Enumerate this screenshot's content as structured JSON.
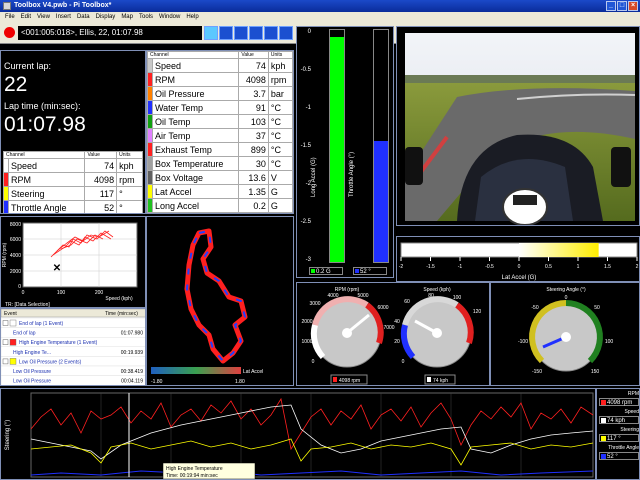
{
  "window": {
    "title": "Toolbox V4.pwb - Pi Toolbox*"
  },
  "menu": [
    "File",
    "Edit",
    "View",
    "Insert",
    "Data",
    "Display",
    "Map",
    "Tools",
    "Window",
    "Help"
  ],
  "toolbar": {
    "session": "<001:005:018>, Ellis, 22, 01:07.98"
  },
  "lap": {
    "current_label": "Current lap:",
    "current_value": "22",
    "time_label": "Lap time  (min:sec):",
    "time_value": "01:07.98"
  },
  "mini_table": {
    "headers": [
      "Channel",
      "Value",
      "Units"
    ],
    "rows": [
      {
        "name": "Speed",
        "value": "74",
        "unit": "kph",
        "color": "#ffffff"
      },
      {
        "name": "RPM",
        "value": "4098",
        "unit": "rpm",
        "color": "#ff2020"
      },
      {
        "name": "Steering",
        "value": "117",
        "unit": "°",
        "color": "#ffff00"
      },
      {
        "name": "Throttle Angle",
        "value": "52",
        "unit": "°",
        "color": "#2030ff"
      }
    ]
  },
  "channel_table": {
    "headers": [
      "Channel",
      "Value",
      "Units"
    ],
    "rows": [
      {
        "name": "Speed",
        "value": "74",
        "unit": "kph",
        "color": "#c8c8c8"
      },
      {
        "name": "RPM",
        "value": "4098",
        "unit": "rpm",
        "color": "#ff2020"
      },
      {
        "name": "Oil Pressure",
        "value": "3.7",
        "unit": "bar",
        "color": "#ff8000"
      },
      {
        "name": "Water Temp",
        "value": "91",
        "unit": "°C",
        "color": "#2030ff"
      },
      {
        "name": "Oil Temp",
        "value": "103",
        "unit": "°C",
        "color": "#10a010"
      },
      {
        "name": "Air Temp",
        "value": "37",
        "unit": "°C",
        "color": "#e080ff"
      },
      {
        "name": "Exhaust Temp",
        "value": "899",
        "unit": "°C",
        "color": "#ff2020"
      },
      {
        "name": "Box Temperature",
        "value": "30",
        "unit": "°C",
        "color": "#a0a0a0"
      },
      {
        "name": "Box Voltage",
        "value": "13.6",
        "unit": "V",
        "color": "#606060"
      },
      {
        "name": "Lat Accel",
        "value": "1.35",
        "unit": "G",
        "color": "#ffff00"
      },
      {
        "name": "Long Accel",
        "value": "0.2",
        "unit": "G",
        "color": "#20c020"
      }
    ]
  },
  "bars": {
    "long_label": "Long Accel (G)",
    "throttle_label": "Throttle Angle (°)",
    "axis_ticks": [
      "0",
      "-0.5",
      "-1",
      "-1.5",
      "-2",
      "-2.5",
      "-3"
    ],
    "long_value": "0.2 G",
    "throttle_value": "52 °",
    "long_fill": 0.97,
    "throttle_fill": 0.52,
    "long_color": "#00ff00",
    "throttle_color": "#2030ff"
  },
  "lat_bar": {
    "label": "Lat Accel (G)",
    "ticks": [
      "-2",
      "-1.5",
      "-1",
      "-0.5",
      "0",
      "0.5",
      "1",
      "1.5",
      "2"
    ],
    "value": 1.35,
    "min": -2,
    "max": 2
  },
  "scatter": {
    "ylabel": "RPM (rpm)",
    "xlabel": "Speed (kph)",
    "footer": "TR: [Data Selection]",
    "yticks": [
      "8000",
      "6000",
      "4000",
      "2000",
      "0"
    ],
    "xticks": [
      "0",
      "100",
      "200"
    ]
  },
  "events": {
    "headers": [
      "Event",
      "Time (min:sec)"
    ],
    "rows": [
      {
        "label": "End of lap (1 Event)",
        "time": "",
        "group": true,
        "color": "#ffffff"
      },
      {
        "label": "End of lap",
        "time": "01:07.980",
        "group": false,
        "color": ""
      },
      {
        "label": "High Engine Temperature (1 Event)",
        "time": "",
        "group": true,
        "color": "#ff2020"
      },
      {
        "label": "High Engine Te...",
        "time": "00:19.939",
        "group": false,
        "color": ""
      },
      {
        "label": "Low Oil Pressure (2 Events)",
        "time": "",
        "group": true,
        "color": "#ffff00"
      },
      {
        "label": "Low Oil Pressure",
        "time": "00:38.419",
        "group": false,
        "color": ""
      },
      {
        "label": "Low Oil Pressure",
        "time": "00:04.119",
        "group": false,
        "color": ""
      }
    ]
  },
  "track": {
    "legend_label": "Lat Accel",
    "min": "-1.80",
    "max": "1.80"
  },
  "gauges": {
    "rpm": {
      "title": "RPM (rpm)",
      "ticks": [
        "0",
        "1000",
        "2000",
        "3000",
        "4000",
        "5000",
        "6000",
        "7000"
      ],
      "value": "4098 rpm"
    },
    "speed": {
      "title": "Speed (kph)",
      "ticks": [
        "0",
        "20",
        "40",
        "60",
        "80",
        "100",
        "120"
      ],
      "value": "74 kph"
    },
    "steer": {
      "title": "Steering Angle (°)",
      "ticks": [
        "-150",
        "-100",
        "-50",
        "0",
        "50",
        "100",
        "150"
      ]
    }
  },
  "strip": {
    "ylabel": "Steering (°)",
    "tooltip_line1": "High Engine Temperature",
    "tooltip_line2": "Time: 00:19:94 min:sec"
  },
  "legend": [
    {
      "label": "RPM",
      "value": "4098 rpm",
      "color": "#ff2020"
    },
    {
      "label": "Speed",
      "value": "74 kph",
      "color": "#ffffff"
    },
    {
      "label": "Steering",
      "value": "117 °",
      "color": "#ffff00"
    },
    {
      "label": "Throttle Angle",
      "value": "52 °",
      "color": "#2030ff"
    }
  ]
}
